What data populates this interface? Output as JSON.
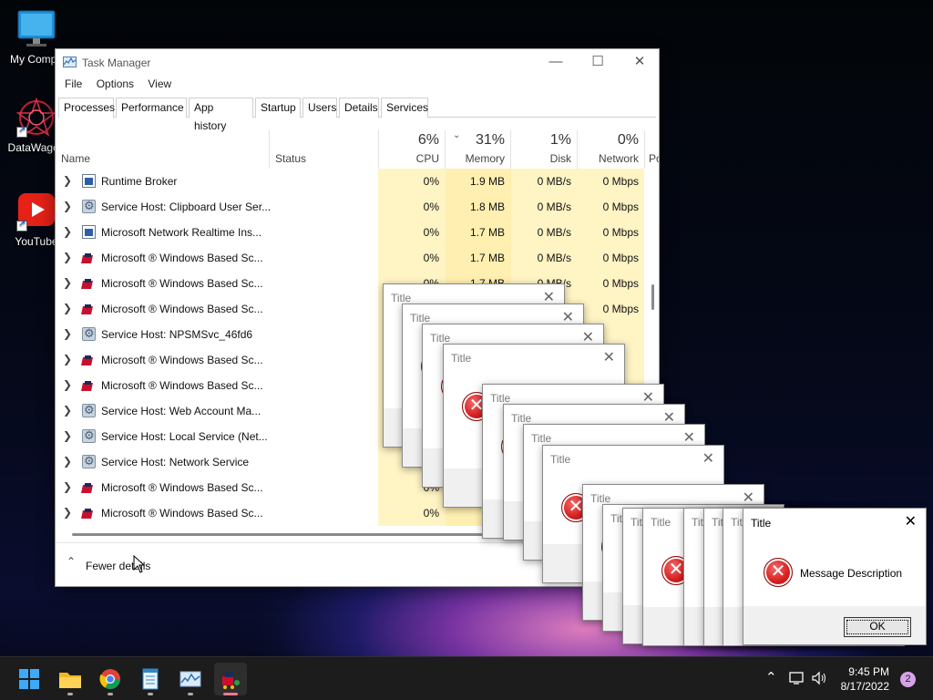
{
  "desktop": {
    "icons": [
      {
        "label": "My Compu",
        "kind": "monitor-icon"
      },
      {
        "label": "DataWagon",
        "kind": "datawagon-icon"
      },
      {
        "label": "YouTube",
        "kind": "youtube-icon"
      }
    ]
  },
  "task_manager": {
    "title": "Task Manager",
    "menu": [
      "File",
      "Options",
      "View"
    ],
    "tabs": [
      "Processes",
      "Performance",
      "App history",
      "Startup",
      "Users",
      "Details",
      "Services"
    ],
    "active_tab": "Processes",
    "columns": {
      "name": "Name",
      "status": "Status",
      "cpu": {
        "pct": "6%",
        "label": "CPU"
      },
      "memory": {
        "pct": "31%",
        "label": "Memory"
      },
      "disk": {
        "pct": "1%",
        "label": "Disk"
      },
      "network": {
        "pct": "0%",
        "label": "Network"
      },
      "power": "Po"
    },
    "rows": [
      {
        "name": "Runtime Broker",
        "icon": "app",
        "cpu": "0%",
        "mem": "1.9 MB",
        "disk": "0 MB/s",
        "net": "0 Mbps"
      },
      {
        "name": "Service Host: Clipboard User Ser...",
        "icon": "gear",
        "cpu": "0%",
        "mem": "1.8 MB",
        "disk": "0 MB/s",
        "net": "0 Mbps"
      },
      {
        "name": "Microsoft Network Realtime Ins...",
        "icon": "app",
        "cpu": "0%",
        "mem": "1.7 MB",
        "disk": "0 MB/s",
        "net": "0 Mbps"
      },
      {
        "name": "Microsoft ® Windows Based Sc...",
        "icon": "red",
        "cpu": "0%",
        "mem": "1.7 MB",
        "disk": "0 MB/s",
        "net": "0 Mbps"
      },
      {
        "name": "Microsoft ® Windows Based Sc...",
        "icon": "red",
        "cpu": "0%",
        "mem": "1.7 MB",
        "disk": "0 MB/s",
        "net": "0 Mbps"
      },
      {
        "name": "Microsoft ® Windows Based Sc...",
        "icon": "red",
        "cpu": "",
        "mem": "",
        "disk": "",
        "net": "0 Mbps"
      },
      {
        "name": "Service Host: NPSMSvc_46fd6",
        "icon": "gear",
        "cpu": "",
        "mem": "",
        "disk": "",
        "net": ""
      },
      {
        "name": "Microsoft ® Windows Based Sc...",
        "icon": "red",
        "cpu": "",
        "mem": "",
        "disk": "",
        "net": ""
      },
      {
        "name": "Microsoft ® Windows Based Sc...",
        "icon": "red",
        "cpu": "",
        "mem": "",
        "disk": "",
        "net": ""
      },
      {
        "name": "Service Host: Web Account Ma...",
        "icon": "gear",
        "cpu": "",
        "mem": "",
        "disk": "",
        "net": ""
      },
      {
        "name": "Service Host: Local Service (Net...",
        "icon": "gear",
        "cpu": "",
        "mem": "",
        "disk": "",
        "net": ""
      },
      {
        "name": "Service Host: Network Service",
        "icon": "gear",
        "cpu": "",
        "mem": "",
        "disk": "",
        "net": ""
      },
      {
        "name": "Microsoft ® Windows Based Sc...",
        "icon": "red",
        "cpu": "0%",
        "mem": "",
        "disk": "",
        "net": ""
      },
      {
        "name": "Microsoft ® Windows Based Sc...",
        "icon": "red",
        "cpu": "0%",
        "mem": "",
        "disk": "",
        "net": ""
      }
    ],
    "footer": "Fewer details"
  },
  "dialogs": {
    "title": "Title",
    "message": "Message Description",
    "ok": "OK"
  },
  "taskbar": {
    "apps": [
      "start-icon",
      "file-explorer-icon",
      "chrome-icon",
      "notepad-icon",
      "task-manager-icon",
      "datawagon-app-icon"
    ],
    "time": "9:45 PM",
    "date": "8/17/2022",
    "notifications": "2"
  }
}
